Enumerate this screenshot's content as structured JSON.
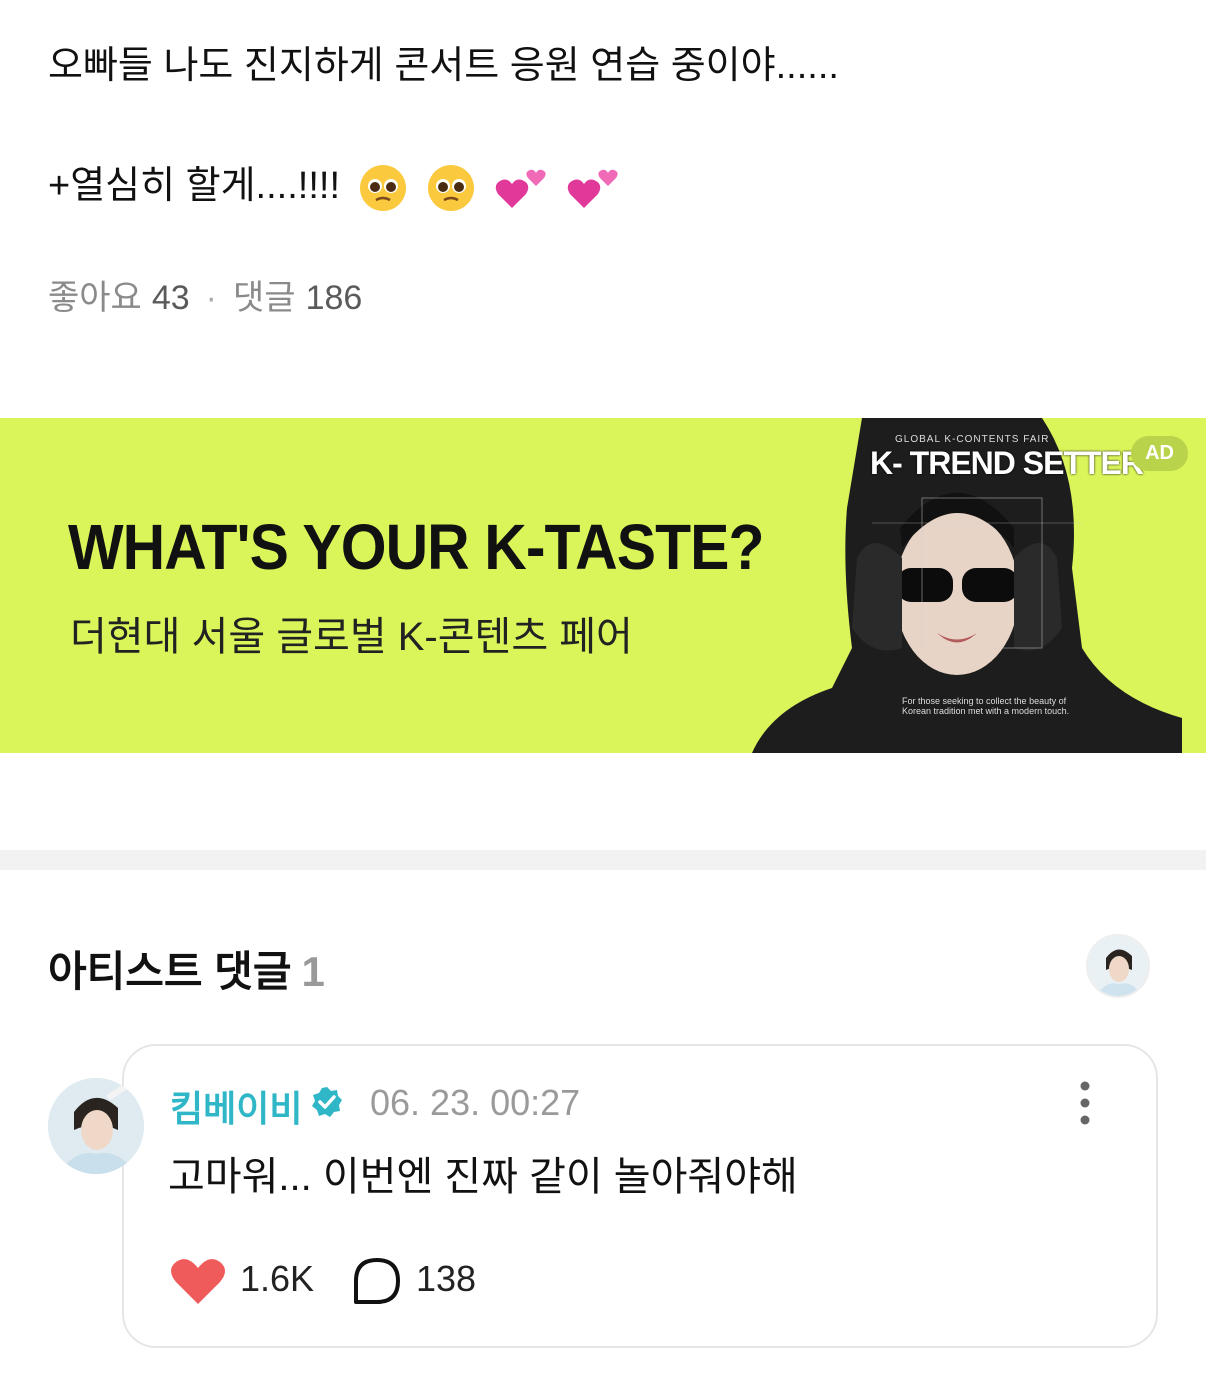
{
  "post": {
    "line1": "오빠들 나도 진지하게 콘서트 응원 연습 중이야......",
    "line2": "+열심히 할게....!!!!",
    "emojis": [
      "pleading-face-icon",
      "pleading-face-icon",
      "two-hearts-icon",
      "two-hearts-icon"
    ]
  },
  "stats": {
    "likes_label": "좋아요",
    "likes_count": "43",
    "separator": "·",
    "comments_label": "댓글",
    "comments_count": "186"
  },
  "ad": {
    "badge": "AD",
    "headline": "WHAT'S YOUR K-TASTE?",
    "subheadline": "더현대 서울 글로벌 K-콘텐츠 페어",
    "visual_top": "GLOBAL K-CONTENTS FAIR",
    "visual_title": "K- TREND SETTER",
    "visual_footer": "For those seeking to collect the beauty of Korean tradition met with a modern touch.",
    "background_color": "#d9f55a"
  },
  "artist_comments": {
    "title": "아티스트 댓글",
    "count": "1"
  },
  "comment": {
    "author": "킴베이비",
    "timestamp": "06. 23. 00:27",
    "text": "고마워... 이번엔 진짜 같이 놀아줘야해",
    "like_count": "1.6K",
    "reply_count": "138",
    "author_color": "#2fb7c7",
    "heart_color": "#ef5b5b"
  }
}
